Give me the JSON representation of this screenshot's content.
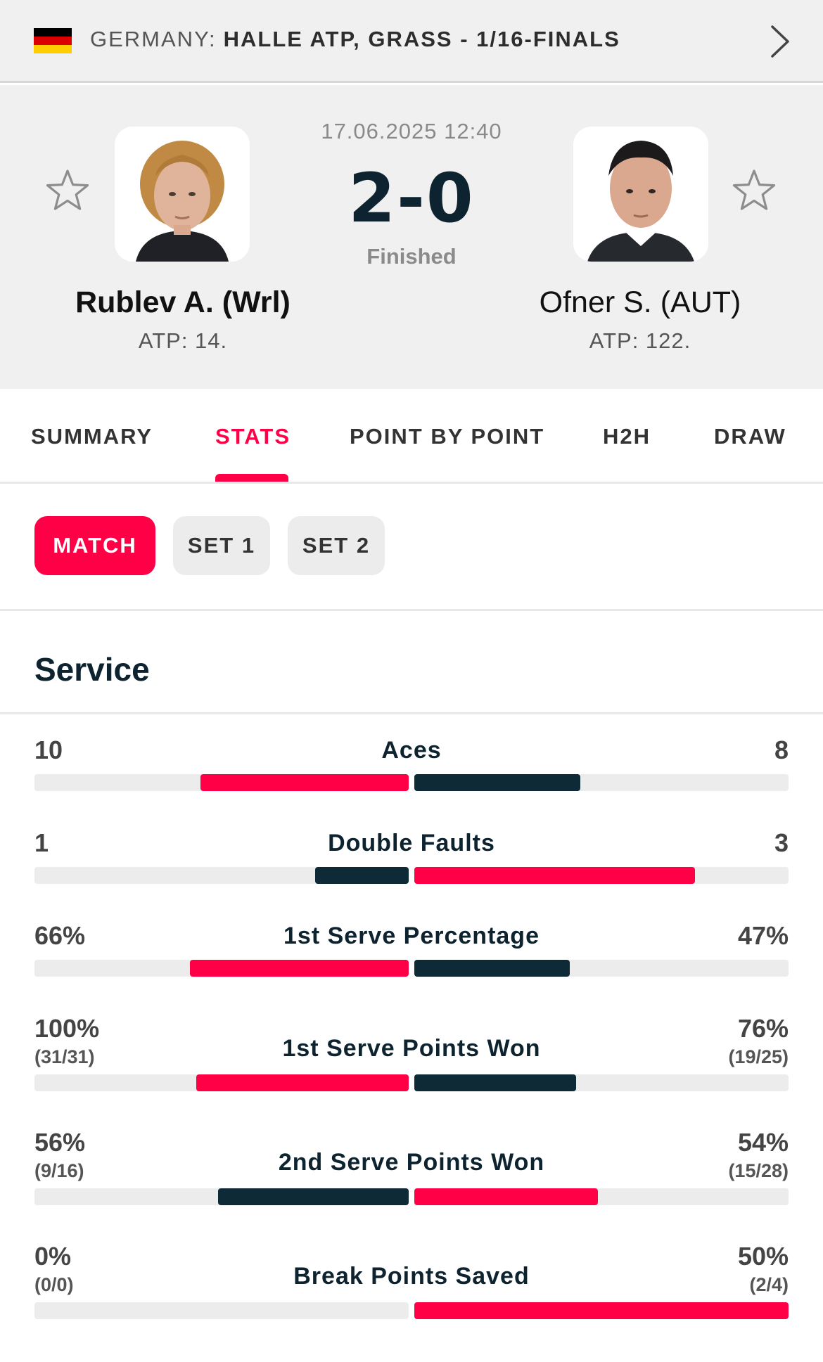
{
  "header": {
    "flag_colors": [
      "#000000",
      "#dd0000",
      "#ffce00"
    ],
    "country": "GERMANY:",
    "tournament": "HALLE ATP, GRASS - 1/16-FINALS",
    "icons": {
      "flag": "germany-flag-icon",
      "next": "chevron-right-icon"
    }
  },
  "match": {
    "date": "17.06.2025 12:40",
    "score": "2-0",
    "status": "Finished",
    "home": {
      "name": "Rublev A. (Wrl)",
      "rank": "ATP: 14."
    },
    "away": {
      "name": "Ofner S. (AUT)",
      "rank": "ATP: 122."
    }
  },
  "tabs": [
    {
      "label": "SUMMARY",
      "active": false
    },
    {
      "label": "STATS",
      "active": true
    },
    {
      "label": "POINT BY POINT",
      "active": false
    },
    {
      "label": "H2H",
      "active": false
    },
    {
      "label": "DRAW",
      "active": false
    }
  ],
  "periods": [
    {
      "label": "MATCH",
      "active": true
    },
    {
      "label": "SET 1",
      "active": false
    },
    {
      "label": "SET 2",
      "active": false
    }
  ],
  "section": {
    "title": "Service"
  },
  "colors": {
    "accent": "#ff0046",
    "dark": "#0e2a36",
    "track": "#ececec"
  },
  "stats": [
    {
      "label": "Aces",
      "home": "10",
      "away": "8",
      "home_sub": "",
      "away_sub": "",
      "home_share": 0.5556,
      "away_share": 0.4444,
      "winner": "home"
    },
    {
      "label": "Double Faults",
      "home": "1",
      "away": "3",
      "home_sub": "",
      "away_sub": "",
      "home_share": 0.25,
      "away_share": 0.75,
      "winner": "away"
    },
    {
      "label": "1st Serve Percentage",
      "home": "66%",
      "away": "47%",
      "home_sub": "",
      "away_sub": "",
      "home_share": 0.584,
      "away_share": 0.416,
      "winner": "home"
    },
    {
      "label": "1st Serve Points Won",
      "home": "100%",
      "away": "76%",
      "home_sub": "(31/31)",
      "away_sub": "(19/25)",
      "home_share": 0.568,
      "away_share": 0.432,
      "winner": "home"
    },
    {
      "label": "2nd Serve Points Won",
      "home": "56%",
      "away": "54%",
      "home_sub": "(9/16)",
      "away_sub": "(15/28)",
      "home_share": 0.509,
      "away_share": 0.491,
      "winner": "away"
    },
    {
      "label": "Break Points Saved",
      "home": "0%",
      "away": "50%",
      "home_sub": "(0/0)",
      "away_sub": "(2/4)",
      "home_share": 0.0,
      "away_share": 1.0,
      "winner": "away"
    }
  ]
}
